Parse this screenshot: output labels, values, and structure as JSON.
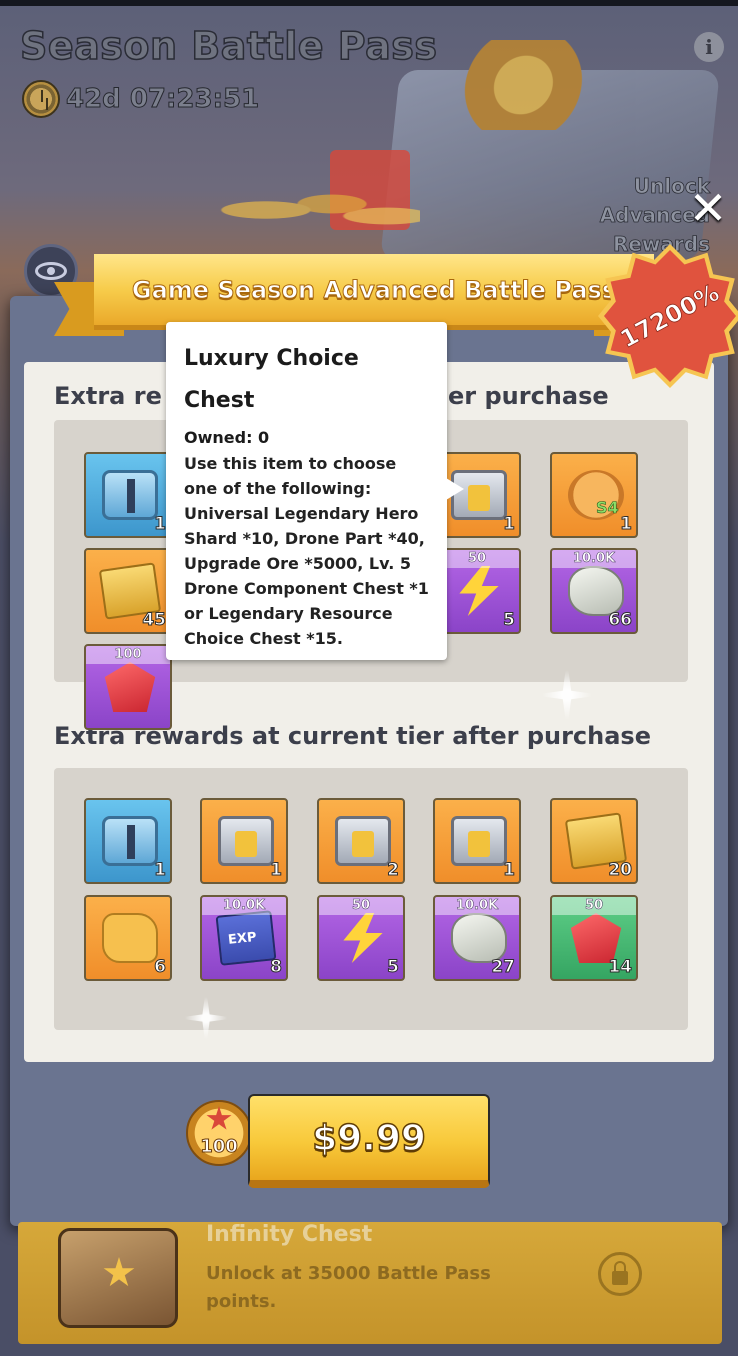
{
  "header": {
    "title": "Season Battle Pass",
    "timer": "42d 07:23:51",
    "info_icon": "info-icon",
    "unlock_line1": "Unlock Advanced",
    "unlock_line2": "Rewards"
  },
  "modal": {
    "ribbon_title": "Game Season Advanced Battle Pass",
    "badge_percent": "17200%",
    "section1_title": "Extra rewards for all tiers after purchase",
    "section1_visible_left": "Extra re",
    "section1_visible_right": "er purchase",
    "section2_title": "Extra rewards at current tier after purchase",
    "tier_items": [
      {
        "art": "chest-blue",
        "color": "blue",
        "count": "1"
      },
      {
        "art": "chest-gold",
        "color": "orange",
        "count": "1"
      },
      {
        "art": "skill",
        "color": "orange",
        "count": "1",
        "label": "S4"
      },
      {
        "art": "tickets",
        "color": "orange",
        "count": "45"
      },
      {
        "art": "bolt",
        "color": "purple",
        "top": "50",
        "count": "5"
      },
      {
        "art": "ore",
        "color": "purple",
        "top": "10.0K",
        "count": "66"
      },
      {
        "art": "gem",
        "color": "purple",
        "top": "100",
        "count": ""
      }
    ],
    "current_items": [
      {
        "art": "chest-blue",
        "color": "blue",
        "count": "1"
      },
      {
        "art": "chest-gold",
        "color": "orange",
        "count": "1"
      },
      {
        "art": "chest-gold",
        "color": "orange",
        "count": "2"
      },
      {
        "art": "chest-gold",
        "color": "orange",
        "count": "1"
      },
      {
        "art": "tickets",
        "color": "orange",
        "count": "20"
      },
      {
        "art": "puzzle",
        "color": "orange",
        "count": "6"
      },
      {
        "art": "book",
        "color": "purple",
        "top": "10.0K",
        "count": "8"
      },
      {
        "art": "bolt",
        "color": "purple",
        "top": "50",
        "count": "5"
      },
      {
        "art": "ore",
        "color": "purple",
        "top": "10.0K",
        "count": "27"
      },
      {
        "art": "gem",
        "color": "green",
        "top": "50",
        "count": "14"
      }
    ]
  },
  "tooltip": {
    "title_line1": "Luxury Choice",
    "title_line2": "Chest",
    "owned": "Owned: 0",
    "description": "Use this item to choose one of the following: Universal Legendary Hero Shard *10, Drone Part *40, Upgrade Ore *5000, Lv. 5 Drone Component Chest *1 or Legendary Resource Choice Chest *15."
  },
  "purchase": {
    "points": "100",
    "price": "$9.99"
  },
  "bottom_card": {
    "title": "Infinity Chest",
    "description": "Unlock at 35000 Battle Pass points."
  },
  "colors": {
    "accent_gold": "#f8c93a",
    "modal_frame": "#6a7490",
    "panel": "#f1efe9",
    "badge_red": "#e0533e"
  }
}
